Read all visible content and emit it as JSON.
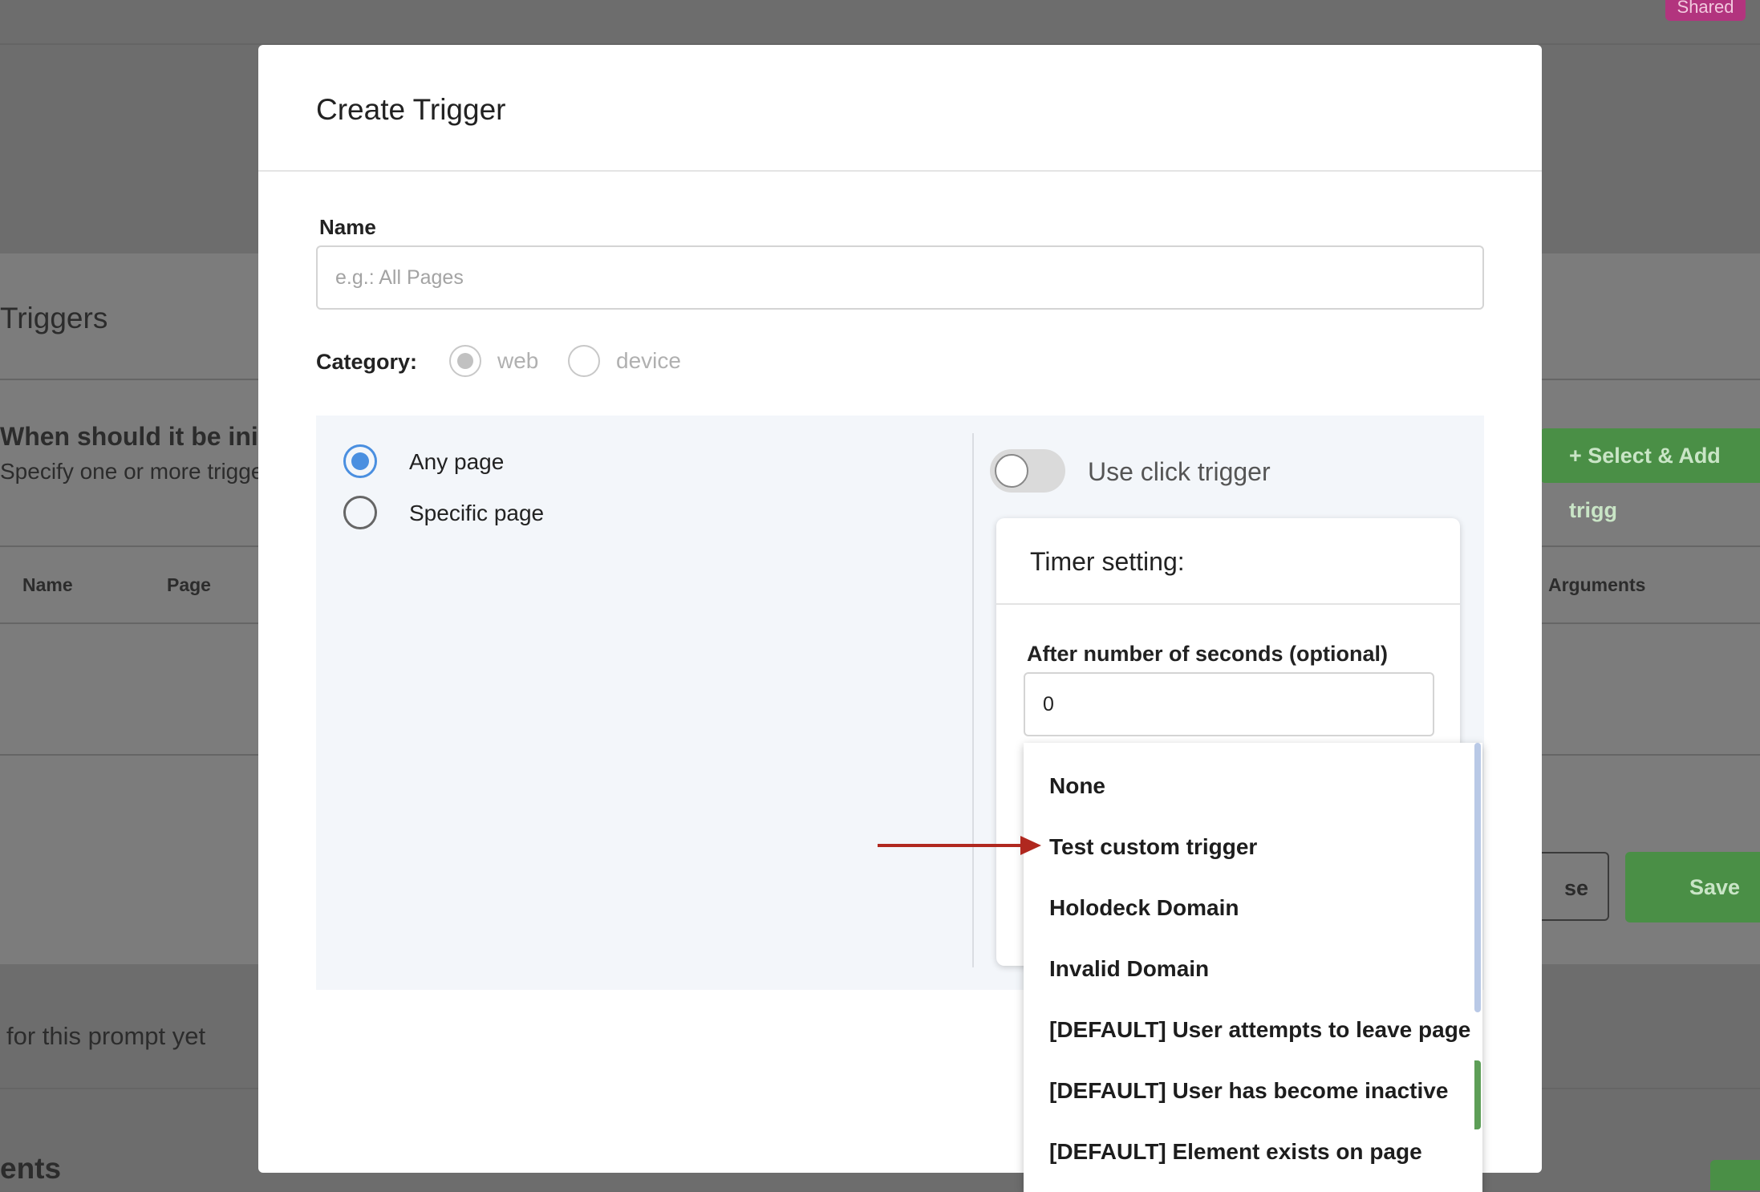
{
  "background": {
    "shared_badge": "Shared",
    "section_title": "Triggers",
    "question": "When should it be init",
    "hint": "Specify one or more trigge",
    "add_button": "+ Select & Add trigg",
    "columns": [
      "Name",
      "Page",
      "Arguments"
    ],
    "close_button": "se",
    "save_button": "Save",
    "empty_message": "for this prompt yet",
    "bottom_heading": "ents"
  },
  "modal": {
    "title": "Create Trigger",
    "name_label": "Name",
    "name_value": "",
    "name_placeholder": "e.g.: All Pages",
    "category_label": "Category:",
    "category_options": [
      "web",
      "device"
    ],
    "category_selected": "web",
    "page_options": [
      "Any page",
      "Specific page"
    ],
    "page_selected": "Any page",
    "click_trigger_label": "Use click trigger",
    "click_trigger_enabled": false,
    "timer": {
      "title": "Timer setting:",
      "seconds_label": "After number of seconds (optional)",
      "seconds_value": "0"
    }
  },
  "dropdown": {
    "items": [
      "None",
      "Test custom trigger",
      "Holodeck Domain",
      "Invalid Domain",
      "[DEFAULT] User attempts to leave page",
      "[DEFAULT] User has become inactive",
      "[DEFAULT] Element exists on page"
    ],
    "highlighted": "Test custom trigger"
  },
  "colors": {
    "accent_blue": "#4a8fe0",
    "annotation_arrow": "#b0281f",
    "green_button": "#4a8f46",
    "badge": "#b2347e"
  }
}
